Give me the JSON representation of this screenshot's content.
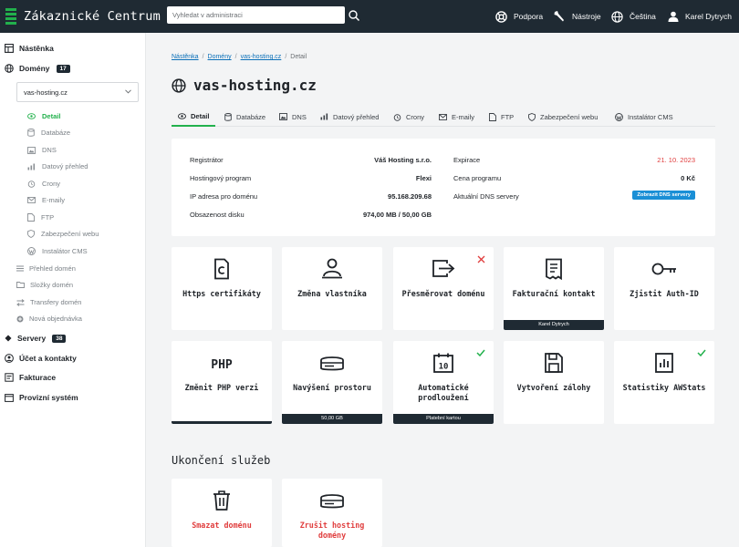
{
  "app": {
    "title": "Zákaznické Centrum"
  },
  "search": {
    "placeholder": "Vyhledat v administraci"
  },
  "topnav": {
    "support": "Podpora",
    "tools": "Nástroje",
    "language": "Čeština",
    "user": "Karel Dytrych"
  },
  "sidebar": {
    "dashboard": "Nástěnka",
    "domains": "Domény",
    "domains_count": "17",
    "domain_select": "vas-hosting.cz",
    "sub_items": [
      "Detail",
      "Databáze",
      "DNS",
      "Datový přehled",
      "Crony",
      "E-maily",
      "FTP",
      "Zabezpečení webu",
      "Instalátor CMS"
    ],
    "domain_links": [
      "Přehled domén",
      "Složky domén",
      "Transfery domén",
      "Nová objednávka"
    ],
    "servers": "Servery",
    "servers_count": "38",
    "account": "Účet a kontakty",
    "billing": "Fakturace",
    "ops": "Provizní systém"
  },
  "breadcrumb": {
    "items": [
      "Nástěnka",
      "Domény",
      "vas-hosting.cz"
    ],
    "current": "Detail"
  },
  "page": {
    "title": "vas-hosting.cz"
  },
  "tabs": [
    "Detail",
    "Databáze",
    "DNS",
    "Datový přehled",
    "Crony",
    "E-maily",
    "FTP",
    "Zabezpečení webu",
    "Instalátor CMS"
  ],
  "info": {
    "left": [
      {
        "label": "Registrátor",
        "value": "Váš Hosting s.r.o."
      },
      {
        "label": "Hostingový program",
        "value": "Flexi"
      },
      {
        "label": "IP adresa pro doménu",
        "value": "95.168.209.68"
      },
      {
        "label": "Obsazenost disku",
        "value": "974,00 MB / 50,00 GB"
      }
    ],
    "expiry_label": "Expirace",
    "expiry_value": "21. 10. 2023",
    "price_label": "Cena programu",
    "price_value": "0 Kč",
    "dns_label": "Aktuální DNS servery",
    "dns_button": "Zobrazit DNS servery"
  },
  "tiles": [
    {
      "label": "Https certifikáty",
      "icon": "certificate-icon"
    },
    {
      "label": "Změna vlastníka",
      "icon": "owner-icon"
    },
    {
      "label": "Přesměrovat doménu",
      "icon": "redirect-icon",
      "status": "cross"
    },
    {
      "label": "Fakturační kontakt",
      "icon": "invoice-icon",
      "footer": "Karel Dytrych"
    },
    {
      "label": "Zjistit Auth-ID",
      "icon": "key-icon"
    },
    {
      "label": "Změnit PHP verzi",
      "icon": "php-icon"
    },
    {
      "label": "Navýšení prostoru",
      "icon": "storage-icon",
      "footer": "50,00 GB"
    },
    {
      "label": "Automatické prodloužení",
      "icon": "calendar-icon",
      "status": "check",
      "footer": "Platební kartou"
    },
    {
      "label": "Vytvoření zálohy",
      "icon": "backup-icon"
    },
    {
      "label": "Statistiky AWStats",
      "icon": "stats-icon",
      "status": "check"
    }
  ],
  "termination": {
    "title": "Ukončení služeb",
    "tiles": [
      {
        "label": "Smazat doménu",
        "icon": "trash-icon"
      },
      {
        "label": "Zrušit hosting domény",
        "icon": "storage-icon"
      }
    ]
  },
  "colors": {
    "accent": "#22b14c",
    "dark": "#1f2a33",
    "danger": "#e03e3e",
    "link": "#0a6fb8",
    "info": "#1a8fd6"
  }
}
